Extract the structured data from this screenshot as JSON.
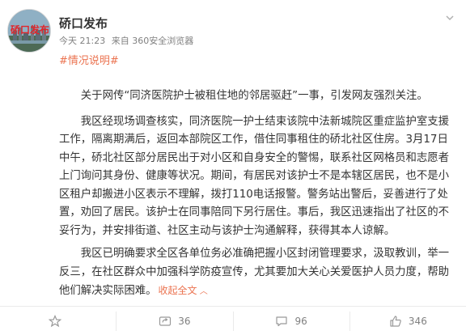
{
  "post": {
    "avatar_label": "硚口发布",
    "author": "硚口发布",
    "time": "今天 21:23",
    "source": "来自 360安全浏览器",
    "topic_tag": "#情况说明#",
    "paragraphs": [
      "关于网传“同济医院护士被租住地的邻居驱赶”一事，引发网友强烈关注。",
      "我区经现场调查核实，同济医院一护士结束该院中法新城院区重症监护室支援工作，隔离期满后，返回本部院区工作，借住同事租住的硚北社区住房。3月17日中午，硚北社区部分居民出于对小区和自身安全的警惕，联系社区网格员和志愿者上门询问其身份、健康等状况。期间，有居民对该护士不是本辖区居民，也不是小区租户却搬进小区表示不理解，拨打110电话报警。警务站出警后，妥善进行了处置，劝回了居民。该护士在同事陪同下另行居住。事后，我区迅速指出了社区的不妥行为，并安排街道、社区主动与该护士沟通解释，获得其本人谅解。",
      "我区已明确要求全区各单位务必准确把握小区封闭管理要求，汲取教训，举一反三，在社区群众中加强科学防疫宣传，尤其要加大关心关爱医护人员力度，帮助他们解决实际困难。"
    ],
    "collapse_label": "收起全文",
    "collapse_icon": "chevron-up-icon"
  },
  "actions": {
    "favorite_icon": "star-icon",
    "share_icon": "repost-icon",
    "share_count": "36",
    "comment_icon": "comment-icon",
    "comment_count": "96",
    "like_icon": "thumbs-up-icon",
    "like_count": "346"
  },
  "colors": {
    "accent": "#eb7350",
    "text": "#333333",
    "muted": "#808080",
    "avatar_text": "#e0262b"
  }
}
